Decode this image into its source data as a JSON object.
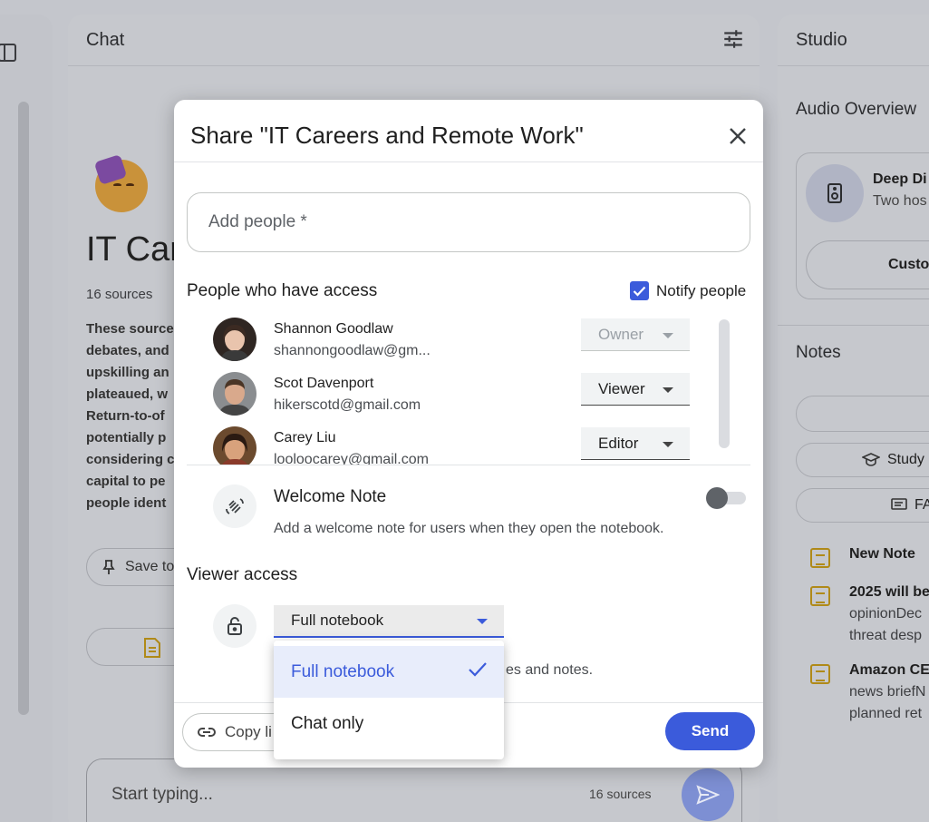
{
  "left_panel": {},
  "chat": {
    "header_title": "Chat",
    "notebook_title": "IT Car",
    "sources_count": "16 sources",
    "summary_lines": [
      "These source",
      "debates, and",
      "upskilling an",
      "plateaued, w",
      "Return-to-of",
      "potentially p",
      "considering c",
      "capital to pe",
      "people ident"
    ],
    "save_button_label": "Save to",
    "input_placeholder": "Start typing...",
    "input_sources": "16 sources"
  },
  "studio": {
    "header_title": "Studio",
    "audio_overview_label": "Audio Overview",
    "deep_dive_title": "Deep Di",
    "deep_dive_subtitle": "Two hos",
    "customize_label": "Custo",
    "notes_label": "Notes",
    "study_label": "Study",
    "faq_label": "FA",
    "notes": [
      {
        "title": "New Note",
        "lines": []
      },
      {
        "title": "2025 will be",
        "lines": [
          "opinionDec",
          "threat desp"
        ]
      },
      {
        "title": "Amazon CE",
        "lines": [
          "news briefN",
          "planned ret"
        ]
      }
    ]
  },
  "dialog": {
    "title": "Share \"IT Careers and Remote Work\"",
    "add_people_placeholder": "Add people *",
    "people_access_label": "People who have access",
    "notify_label": "Notify people",
    "notify_checked": true,
    "people": [
      {
        "name": "Shannon Goodlaw",
        "email": "shannongoodlaw@gm...",
        "role": "Owner",
        "role_disabled": true
      },
      {
        "name": "Scot Davenport",
        "email": "hikerscotd@gmail.com",
        "role": "Viewer",
        "role_disabled": false
      },
      {
        "name": "Carey Liu",
        "email": "looloocarey@gmail.com",
        "role": "Editor",
        "role_disabled": false
      }
    ],
    "welcome_note_title": "Welcome Note",
    "welcome_note_desc": "Add a welcome note for users when they open the notebook.",
    "welcome_note_enabled": false,
    "viewer_access_label": "Viewer access",
    "viewer_access_value": "Full notebook",
    "viewer_access_desc_tail": "es and notes.",
    "copy_link_label": "Copy li",
    "send_label": "Send"
  },
  "viewer_menu": {
    "options": [
      {
        "label": "Full notebook",
        "selected": true
      },
      {
        "label": "Chat only",
        "selected": false
      }
    ]
  },
  "colors": {
    "accent": "#3b5bdb",
    "note_icon": "#b08a18",
    "backdrop": "#c4c6cc"
  }
}
